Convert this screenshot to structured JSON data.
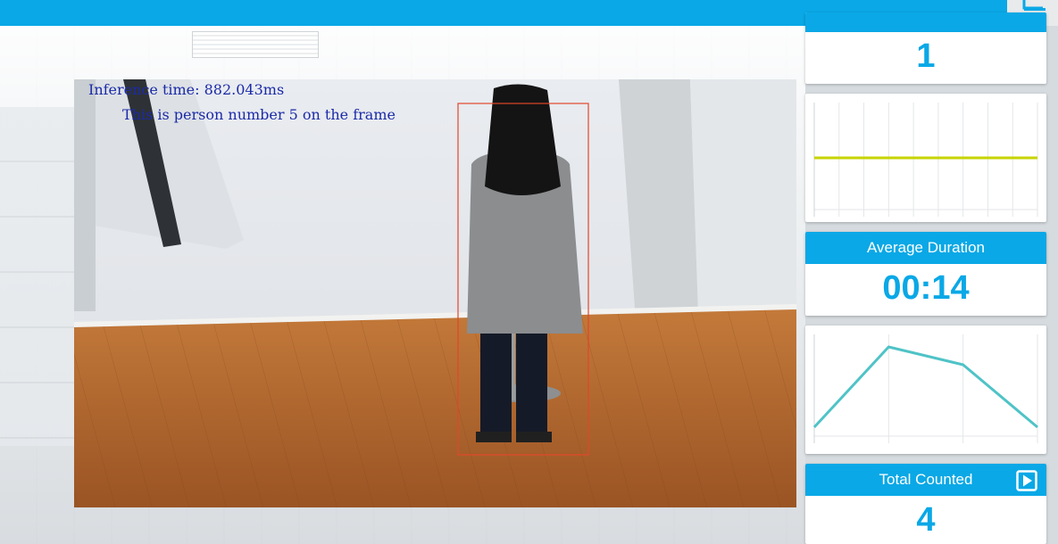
{
  "colors": {
    "accent": "#0aa8e6",
    "value_text": "#0aa8e6",
    "chart_line_current": "#c8d400",
    "chart_line_duration": "#4fc3c7",
    "bbox": "#e2462a",
    "overlay_text": "#1b2aa8"
  },
  "video": {
    "inference_label": "Inference time: 882.043ms",
    "person_label": "This is person number 5 on the frame"
  },
  "panels": {
    "current_count_value": "1",
    "average_duration": {
      "title": "Average Duration",
      "value": "00:14"
    },
    "total_counted": {
      "title": "Total Counted",
      "value": "4",
      "icon": "play-icon"
    }
  },
  "icons": {
    "top_right": "screen-icon"
  },
  "chart_data": [
    {
      "type": "line",
      "title": "",
      "x": [
        0,
        1,
        2,
        3,
        4,
        5,
        6,
        7,
        8,
        9
      ],
      "series": [
        {
          "values": [
            1,
            1,
            1,
            1,
            1,
            1,
            1,
            1,
            1,
            1
          ]
        }
      ],
      "ylim": [
        0,
        2
      ],
      "grid": "vertical"
    },
    {
      "type": "line",
      "title": "",
      "x": [
        0,
        1,
        2,
        3
      ],
      "series": [
        {
          "values": [
            1,
            10,
            8,
            1
          ]
        }
      ],
      "ylim": [
        0,
        11
      ],
      "grid": "vertical"
    }
  ]
}
